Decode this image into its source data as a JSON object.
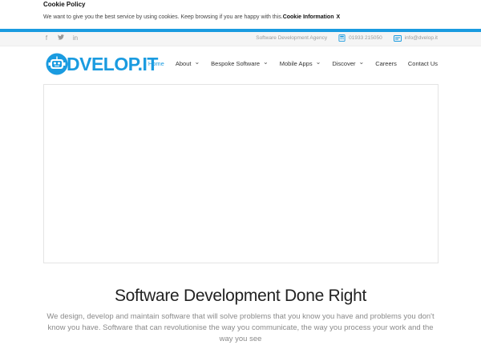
{
  "cookie": {
    "title": "Cookie Policy",
    "text": "We want to give you the best service by using cookies. Keep browsing if you are happy with this.",
    "link": "Cookie Information",
    "close": "X"
  },
  "topbar": {
    "social": [
      "f",
      "ὂ6",
      "in"
    ],
    "tagline": "Software Development Agency",
    "phone": "01933 215050",
    "email": "info@dvelop.it"
  },
  "header": {
    "logo_text": "DVELOP.IT",
    "nav": [
      {
        "label": "Home",
        "active": true,
        "dropdown": false
      },
      {
        "label": "About",
        "active": false,
        "dropdown": true
      },
      {
        "label": "Bespoke Software",
        "active": false,
        "dropdown": true
      },
      {
        "label": "Mobile Apps",
        "active": false,
        "dropdown": true
      },
      {
        "label": "Discover",
        "active": false,
        "dropdown": true
      },
      {
        "label": "Careers",
        "active": false,
        "dropdown": false
      },
      {
        "label": "Contact Us",
        "active": false,
        "dropdown": false
      }
    ]
  },
  "main": {
    "headline": "Software Development Done Right",
    "subtext": "We design, develop and maintain software that will solve problems that you know you have and problems you don't know you have. Software that can revolutionise the way you communicate, the way you process your work and the way you see"
  },
  "colors": {
    "accent": "#1a9be0"
  }
}
